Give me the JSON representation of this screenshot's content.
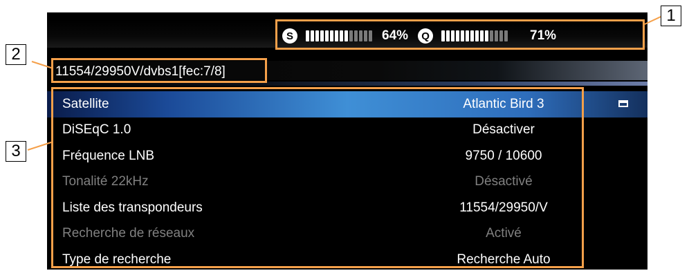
{
  "signal": {
    "strength_icon": "S",
    "quality_icon": "Q",
    "strength_pct": "64%",
    "quality_pct": "71%",
    "strength_fraction": 0.64,
    "quality_fraction": 0.71
  },
  "tuning_info": "11554/29950V/dvbs1[fec:7/8]",
  "settings": [
    {
      "label": "Satellite",
      "value": "Atlantic Bird 3",
      "selected": true,
      "enabled": true
    },
    {
      "label": "DiSEqC 1.0",
      "value": "Désactiver",
      "selected": false,
      "enabled": true
    },
    {
      "label": "Fréquence LNB",
      "value": "9750 / 10600",
      "selected": false,
      "enabled": true
    },
    {
      "label": "Tonalité 22kHz",
      "value": "Désactivé",
      "selected": false,
      "enabled": false
    },
    {
      "label": "Liste des transpondeurs",
      "value": "11554/29950/V",
      "selected": false,
      "enabled": true
    },
    {
      "label": "Recherche de réseaux",
      "value": "Activé",
      "selected": false,
      "enabled": false
    },
    {
      "label": "Type de recherche",
      "value": "Recherche Auto",
      "selected": false,
      "enabled": true
    }
  ],
  "callouts": [
    "1",
    "2",
    "3"
  ],
  "colors": {
    "callout": "#f5a04a",
    "selected_row": "#3f8fd6",
    "disabled_text": "#808080"
  }
}
